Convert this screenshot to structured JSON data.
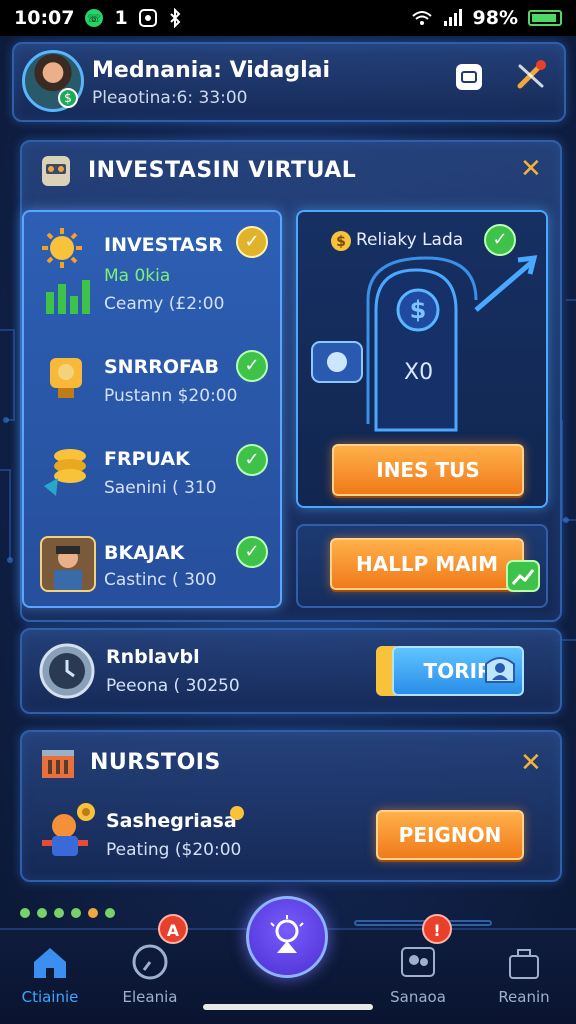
{
  "status_bar": {
    "time": "10:07",
    "indicators": "1",
    "battery": "98%"
  },
  "profile": {
    "name": "Mednania: Vidaglai",
    "subtitle": "Pleaotina:6: 33:00"
  },
  "invest_section": {
    "title": "INVESTASIN VIRTUAL",
    "items": [
      {
        "title": "INVESTASR",
        "sub1": "Ma 0kia",
        "sub2": "Ceamy (£2:00",
        "icon": "sun-icon",
        "check": "gold"
      },
      {
        "title": "SNRROFAB",
        "sub1": "Pustann $20:00",
        "icon": "trophy-icon",
        "check": "green"
      },
      {
        "title": "FRPUAK",
        "sub1": "Saenini ( 310",
        "icon": "coins-icon",
        "check": "green"
      },
      {
        "title": "BKAJAK",
        "sub1": "Castinc ( 300",
        "icon": "avatar-icon",
        "check": "green"
      }
    ],
    "vault": {
      "title": "Reliaky Lada",
      "value": "X0",
      "button": "INES TUS"
    },
    "wallet_button": "HALLP MAIM"
  },
  "balance_row": {
    "title": "Rnblavbl",
    "subtitle": "Peeona ( 30250",
    "button": "TORIR"
  },
  "news_section": {
    "title": "NURSTOIS",
    "item_title": "Sashegriasa",
    "item_sub": "Peating ($20:00",
    "button": "PEIGNON"
  },
  "pager_colors": [
    "#7ad06a",
    "#7ad06a",
    "#7ad06a",
    "#7ad06a",
    "#f0a840",
    "#7ad06a"
  ],
  "nav": {
    "items": [
      {
        "label": "Ctiainie",
        "icon": "home-icon",
        "active": true
      },
      {
        "label": "Eleania",
        "icon": "gauge-icon",
        "badge": "A"
      },
      {
        "label": "Sanaoa",
        "icon": "people-icon",
        "badge": "!"
      },
      {
        "label": "Reanin",
        "icon": "bag-icon"
      }
    ]
  },
  "colors": {
    "accent": "#3aa6ff",
    "orange": "#f07a1a",
    "check": "#3ec24a"
  }
}
